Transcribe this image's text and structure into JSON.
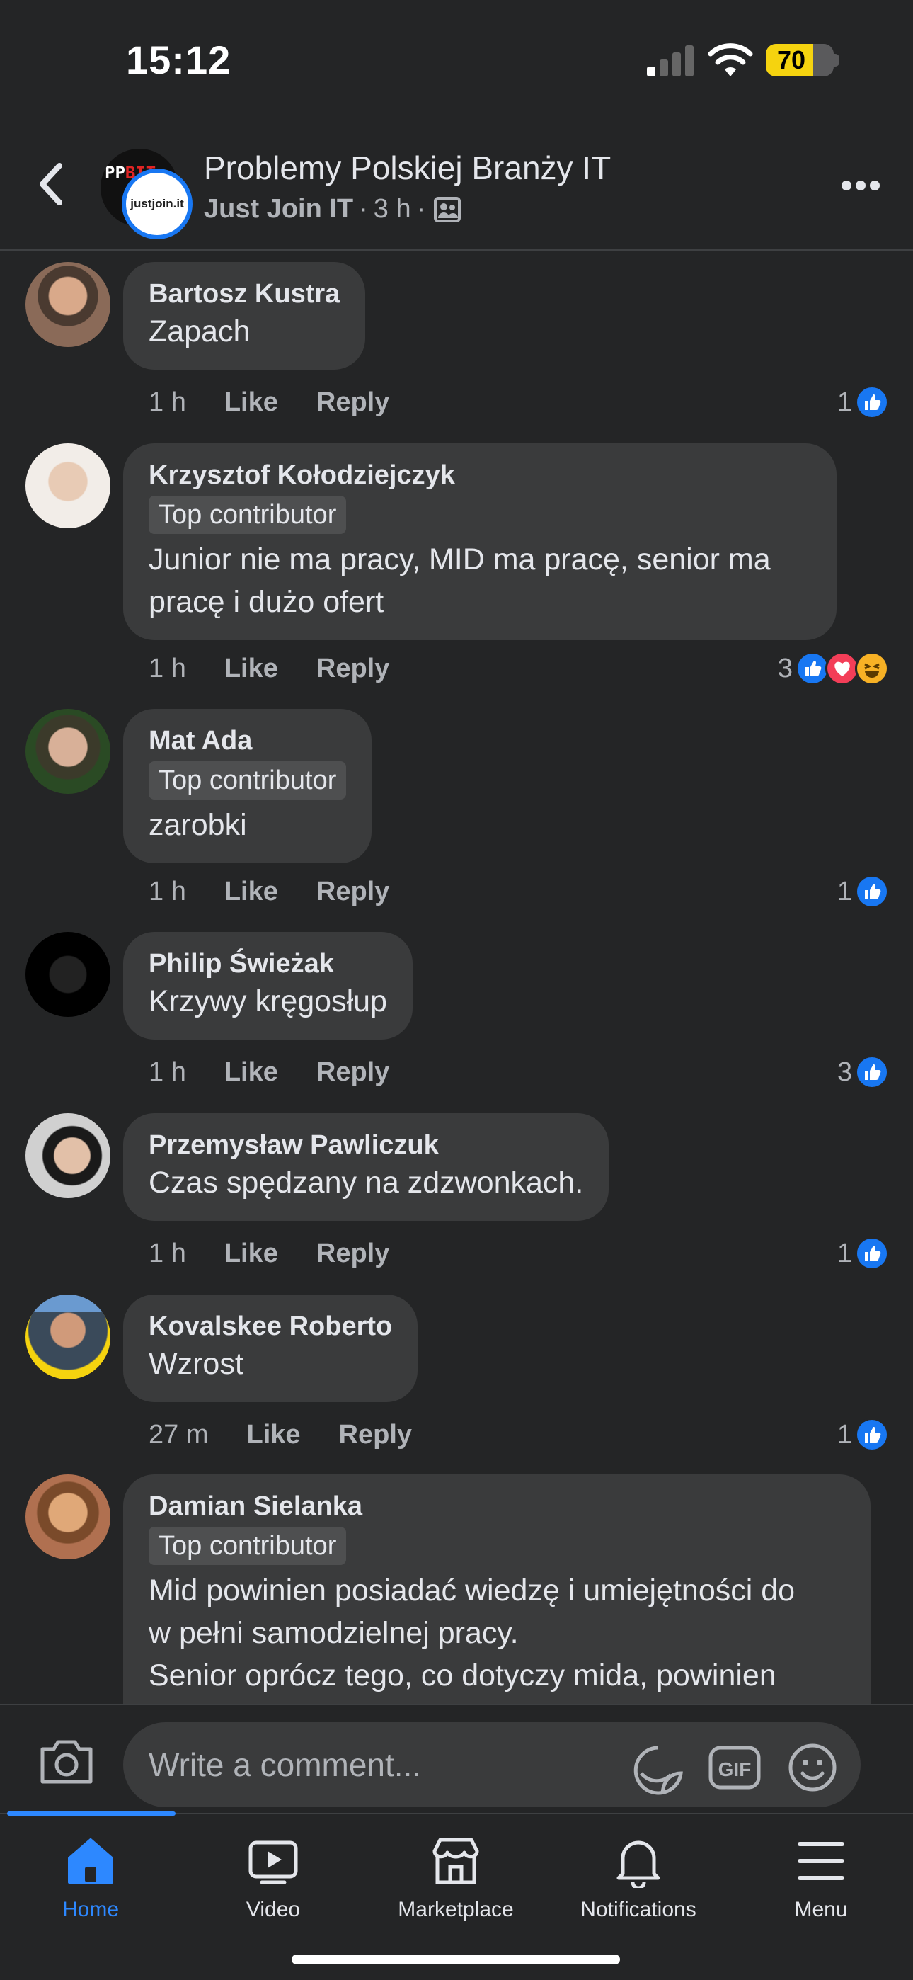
{
  "status_bar": {
    "time": "15:12",
    "battery": "70",
    "battery_level_percent": 70
  },
  "header": {
    "group_name": "Problemy Polskiej Branży IT",
    "page_name": "Just Join IT",
    "separator": "·",
    "time_ago": "3 h",
    "group_avatar_text_a": "PP",
    "group_avatar_text_b": "BIT",
    "page_avatar_text": "justjoin.it"
  },
  "comments": [
    {
      "author": "Bartosz Kustra",
      "badge": "",
      "text": "Zapach",
      "time": "1 h",
      "like_label": "Like",
      "reply_label": "Reply",
      "reaction_count": "1",
      "reactions": [
        "like"
      ]
    },
    {
      "author": "Krzysztof Kołodziejczyk",
      "badge": "Top contributor",
      "text": "Junior nie ma pracy, MID ma pracę, senior ma\npracę i dużo ofert",
      "time": "1 h",
      "like_label": "Like",
      "reply_label": "Reply",
      "reaction_count": "3",
      "reactions": [
        "like",
        "love",
        "haha"
      ]
    },
    {
      "author": "Mat Ada",
      "badge": "Top contributor",
      "text": "zarobki",
      "time": "1 h",
      "like_label": "Like",
      "reply_label": "Reply",
      "reaction_count": "1",
      "reactions": [
        "like"
      ]
    },
    {
      "author": "Philip Świeżak",
      "badge": "",
      "text": "Krzywy kręgosłup",
      "time": "1 h",
      "like_label": "Like",
      "reply_label": "Reply",
      "reaction_count": "3",
      "reactions": [
        "like"
      ]
    },
    {
      "author": "Przemysław Pawliczuk",
      "badge": "",
      "text": "Czas spędzany na zdzwonkach.",
      "time": "1 h",
      "like_label": "Like",
      "reply_label": "Reply",
      "reaction_count": "1",
      "reactions": [
        "like"
      ]
    },
    {
      "author": "Kovalskee Roberto",
      "badge": "",
      "text": "Wzrost",
      "time": "27 m",
      "like_label": "Like",
      "reply_label": "Reply",
      "reaction_count": "1",
      "reactions": [
        "like"
      ]
    },
    {
      "author": "Damian Sielanka",
      "badge": "Top contributor",
      "text": "Mid powinien posiadać wiedzę i umiejętności do\nw pełni samodzielnej pracy.\nSenior oprócz tego, co dotyczy mida, powinien",
      "time": "",
      "like_label": "",
      "reply_label": "",
      "reaction_count": "",
      "reactions": []
    }
  ],
  "composer": {
    "placeholder": "Write a comment...",
    "gif_label": "GIF"
  },
  "tabs": [
    {
      "label": "Home",
      "icon": "home-icon",
      "active": true
    },
    {
      "label": "Video",
      "icon": "video-icon",
      "active": false
    },
    {
      "label": "Marketplace",
      "icon": "marketplace-icon",
      "active": false
    },
    {
      "label": "Notifications",
      "icon": "bell-icon",
      "active": false
    },
    {
      "label": "Menu",
      "icon": "menu-icon",
      "active": false
    }
  ],
  "colors": {
    "accent": "#2d88ff",
    "like": "#1877f2",
    "love": "#f33e58",
    "haha": "#f7b125",
    "battery": "#f5d30f"
  }
}
